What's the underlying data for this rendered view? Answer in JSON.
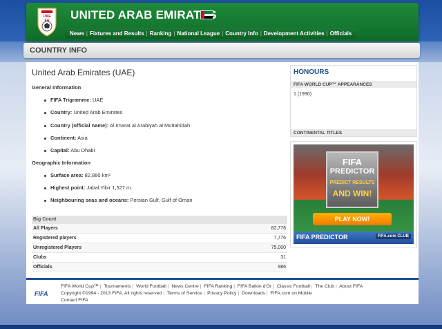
{
  "site": {
    "title": "UNITED ARAB EMIRATES",
    "logo_text": "UAE FA"
  },
  "nav": {
    "items": [
      "News",
      "Fixtures and Results",
      "Ranking",
      "National League",
      "Country Info",
      "Development Activities",
      "Officials"
    ]
  },
  "page": {
    "title": "COUNTRY INFO",
    "country_heading": "United Arab Emirates (UAE)"
  },
  "general": {
    "heading": "General Information",
    "items": [
      {
        "label": "FIFA Trigramme:",
        "value": "UAE"
      },
      {
        "label": "Country:",
        "value": "United Arab Emirates"
      },
      {
        "label": "Country (official name):",
        "value": "Al Imarat al Arabiyah al Muttahidah"
      },
      {
        "label": "Continent:",
        "value": "Asia"
      },
      {
        "label": "Capital:",
        "value": "Abu Dhabi"
      }
    ]
  },
  "geographic": {
    "heading": "Geographic Information",
    "items": [
      {
        "label": "Surface area:",
        "value": "82,880 km²"
      },
      {
        "label": "Highest point:",
        "value": "Jabal Yibir 1,527 m."
      },
      {
        "label": "Neighbouring seas and oceans:",
        "value": "Persian Gulf, Gulf of Oman"
      }
    ]
  },
  "big_count": {
    "heading": "Big Count",
    "rows": [
      {
        "label": "All Players",
        "value": "82,776"
      },
      {
        "label": "Registered players",
        "value": "7,776"
      },
      {
        "label": "Unregistered Players",
        "value": "75,000"
      },
      {
        "label": "Clubs",
        "value": "31"
      },
      {
        "label": "Officials",
        "value": "986"
      }
    ]
  },
  "honours": {
    "title": "HONOURS",
    "world_cup_label": "FIFA WORLD CUP™ APPEARANCES",
    "world_cup_value": "1 (1990)",
    "continental_label": "CONTINENTAL TITLES"
  },
  "promo": {
    "line1": "FIFA",
    "line2": "PREDICTOR",
    "line3": "PREDICT RESULTS",
    "line4": "AND WIN!",
    "cta": "PLAY NOW!",
    "footer_left": "FIFA PREDICTOR",
    "footer_right": "FIFA.com CLUB"
  },
  "footer": {
    "logo": "FIFA",
    "links_row1": [
      "FIFA World Cup™",
      "Tournaments",
      "World Football",
      "News Centre",
      "FIFA Ranking",
      "FIFA Ballon d'Or",
      "Classic Football",
      "The Club",
      "About FIFA"
    ],
    "copyright": "Copyright ©1994 - 2013 FIFA. All rights reserved",
    "links_row2": [
      "Terms of Service",
      "Privacy Policy",
      "Downloads",
      "FIFA.com on Mobile"
    ],
    "contact": "Contact FIFA"
  },
  "colors": {
    "header_green": "#1f8a3a",
    "accent_blue": "#1c4f8c",
    "flag_red": "#c8102e",
    "flag_green": "#00843d"
  }
}
